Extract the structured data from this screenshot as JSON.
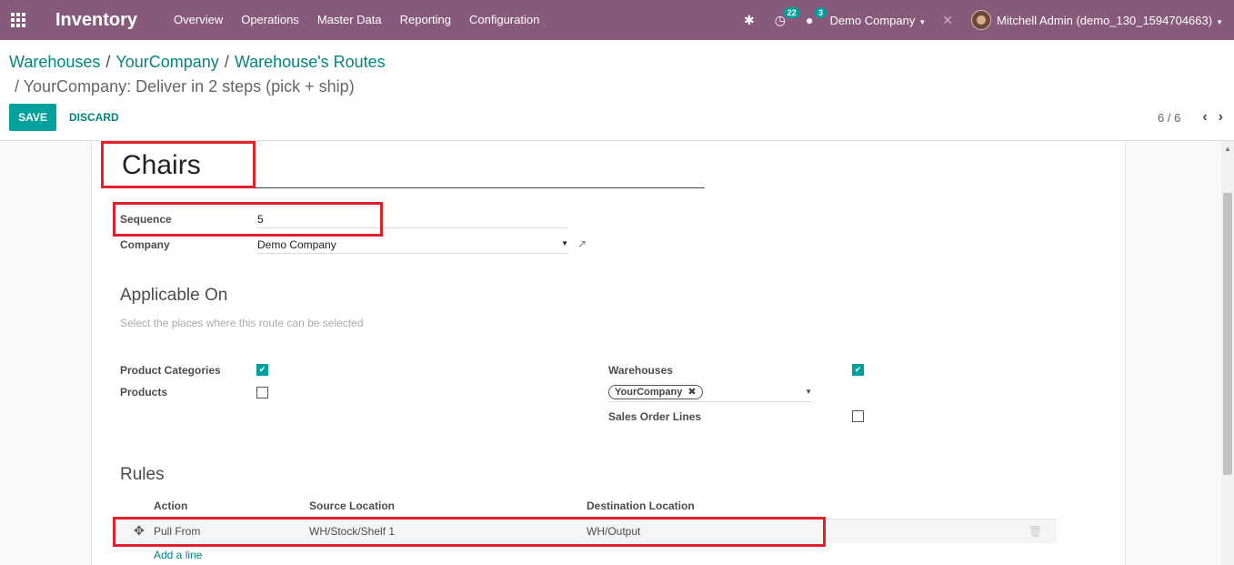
{
  "navbar": {
    "app_name": "Inventory",
    "menu": [
      "Overview",
      "Operations",
      "Master Data",
      "Reporting",
      "Configuration"
    ],
    "activity_count": "22",
    "message_count": "3",
    "company": "Demo Company",
    "user": "Mitchell Admin (demo_130_1594704663)"
  },
  "breadcrumb": {
    "items": [
      "Warehouses",
      "YourCompany",
      "Warehouse's Routes"
    ],
    "current": "YourCompany: Deliver in 2 steps (pick + ship)"
  },
  "toolbar": {
    "save_label": "SAVE",
    "discard_label": "DISCARD",
    "pager": "6 / 6"
  },
  "form": {
    "name": "Chairs",
    "sequence_label": "Sequence",
    "sequence_value": "5",
    "company_label": "Company",
    "company_value": "Demo Company",
    "applicable_title": "Applicable On",
    "applicable_help": "Select the places where this route can be selected",
    "product_categories_label": "Product Categories",
    "product_categories_checked": true,
    "products_label": "Products",
    "products_checked": false,
    "warehouses_label": "Warehouses",
    "warehouses_checked": true,
    "warehouse_tag": "YourCompany",
    "sales_order_lines_label": "Sales Order Lines",
    "sales_order_lines_checked": false
  },
  "rules": {
    "title": "Rules",
    "columns": [
      "Action",
      "Source Location",
      "Destination Location"
    ],
    "rows": [
      {
        "action": "Pull From",
        "source": "WH/Stock/Shelf 1",
        "destination": "WH/Output"
      }
    ],
    "add_line": "Add a line"
  }
}
